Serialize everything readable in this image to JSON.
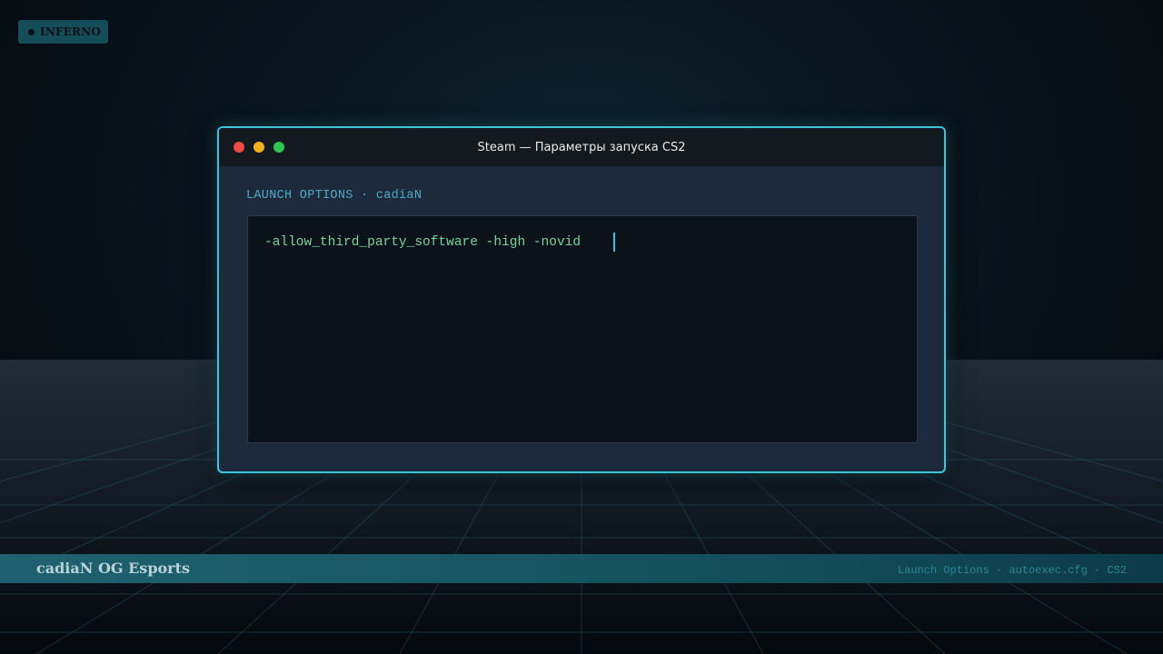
{
  "map_badge": {
    "label": "INFERNO",
    "icon": "dot-icon"
  },
  "window": {
    "title": "Steam — Параметры запуска CS2",
    "controls": [
      "close-icon",
      "minimize-icon",
      "maximize-icon"
    ],
    "section_label": "LAUNCH OPTIONS · cadiaN",
    "launch_options_value": "-allow_third_party_software -high -novid"
  },
  "footer": {
    "brand": "cadiaN OG Esports",
    "meta": "Launch Options · autoexec.cfg · CS2"
  },
  "colors": {
    "accent": "#3fc3dc",
    "close": "#ec4b46",
    "minimize": "#f3b21d",
    "maximize": "#2ec652",
    "option_text": "#79d49b",
    "label_text": "#4fa9c9"
  }
}
